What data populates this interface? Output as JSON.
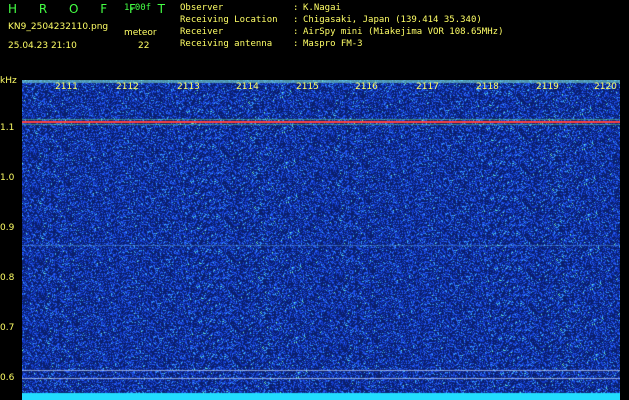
{
  "header": {
    "title": "H R O F F T",
    "version": "1.00f",
    "filename": "KN9_2504232110.png",
    "datetime": "25.04.23 21:10",
    "meteor_label": "meteor",
    "meteor_count": "22"
  },
  "info": [
    {
      "key": "Observer",
      "sep": ":",
      "value": "K.Nagai"
    },
    {
      "key": "Receiving Location",
      "sep": ":",
      "value": "Chigasaki, Japan (139.414 35.340)"
    },
    {
      "key": "Receiver",
      "sep": ":",
      "value": "AirSpy mini (Miakejima VOR 108.65MHz)"
    },
    {
      "key": "Receiving antenna",
      "sep": ":",
      "value": "Maspro FM-3"
    }
  ],
  "y_axis": {
    "unit": "kHz",
    "ticks": [
      "1.1",
      "1.0",
      "0.9",
      "0.8",
      "0.7",
      "0.6"
    ]
  },
  "x_axis": {
    "ticks": [
      "2111",
      "2112",
      "2113",
      "2114",
      "2115",
      "2116",
      "2117",
      "2118",
      "2119",
      "2120"
    ]
  },
  "colors": {
    "background": "#0a1f6e",
    "noise": "#1f4cff",
    "carrier": "#ff4040",
    "text_yellow": "#ffff66",
    "text_green": "#44ff44",
    "baseline": "#22ddff"
  }
}
